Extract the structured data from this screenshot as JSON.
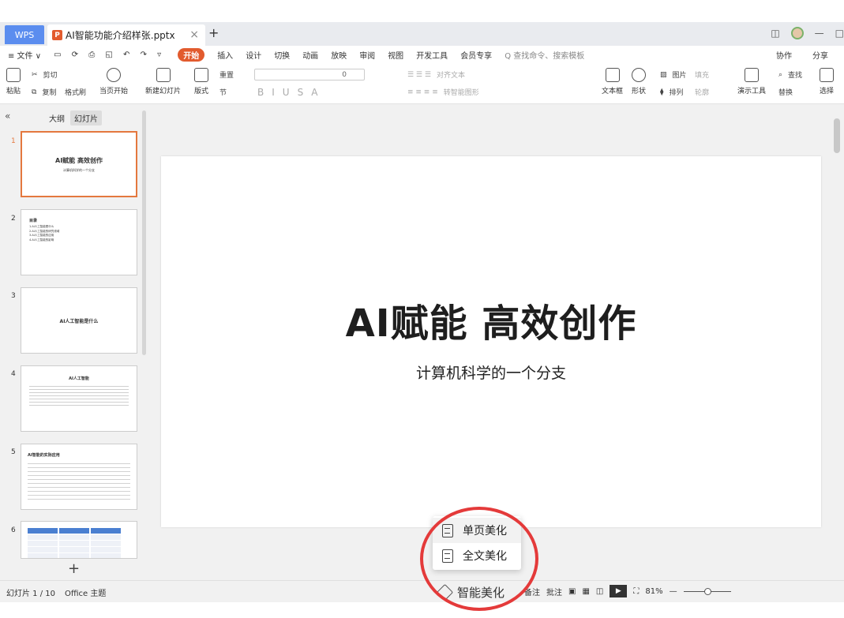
{
  "tabbar": {
    "wps_label": "WPS",
    "doc_title": "AI智能功能介绍样张.pptx",
    "close": "×",
    "add": "+"
  },
  "menu": {
    "items": [
      "≡ 文件 ∨",
      "开始",
      "插入",
      "设计",
      "切换",
      "动画",
      "放映",
      "审阅",
      "视图",
      "开发工具",
      "会员专享"
    ],
    "search_placeholder": "Q 查找命令、搜索模板",
    "right": [
      "协作",
      "分享"
    ]
  },
  "ribbon": {
    "paste": "粘贴",
    "cut": "剪切",
    "copy": "复制",
    "format_painter": "格式刷",
    "from_current": "当页开始",
    "new_slide": "新建幻灯片",
    "layout": "版式",
    "section": "节",
    "reset": "重置",
    "font_size": "0",
    "align_text": "对齐文本",
    "smart_shape": "转智能图形",
    "textbox": "文本框",
    "shape": "形状",
    "picture": "图片",
    "arrange": "排列",
    "fill": "填充",
    "outline": "轮廓",
    "present_tool": "演示工具",
    "find": "查找",
    "replace": "替换",
    "select": "选择"
  },
  "left_panel": {
    "tab_outline": "大纲",
    "tab_slides": "幻灯片",
    "thumbs": [
      {
        "num": "1",
        "title": "AI赋能 高效创作",
        "sub": "计算机科学的一个分支"
      },
      {
        "num": "2",
        "title": "目录",
        "lines": [
          "1.AI人工智能是什么",
          "2.AI人工智能的研究领域",
          "3.AI人工智能的应用",
          "4.AI人工智能的影响"
        ]
      },
      {
        "num": "3",
        "title": "AI人工智能是什么"
      },
      {
        "num": "4",
        "title": "AI人工智能"
      },
      {
        "num": "5",
        "title": "AI智能的实际应用"
      },
      {
        "num": "6"
      }
    ]
  },
  "slide": {
    "title": "AI赋能 高效创作",
    "subtitle": "计算机科学的一个分支"
  },
  "popup": {
    "item1": "单页美化",
    "item2": "全文美化"
  },
  "status": {
    "slide_count": "幻灯片 1 / 10",
    "theme": "Office 主题",
    "smart_beautify": "智能美化",
    "notes": "备注",
    "comments": "批注",
    "zoom": "81%"
  }
}
